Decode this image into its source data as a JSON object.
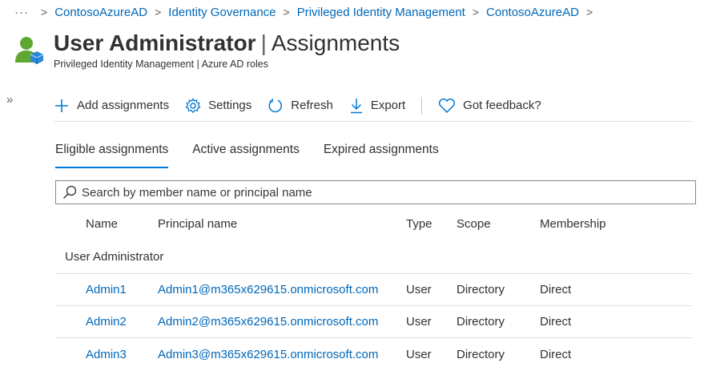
{
  "breadcrumb": {
    "ellipsis": "···",
    "items": [
      "ContosoAzureAD",
      "Identity Governance",
      "Privileged Identity Management",
      "ContosoAzureAD"
    ]
  },
  "header": {
    "title_strong": "User Administrator",
    "title_pipe": "|",
    "title_rest": "Assignments",
    "subtitle": "Privileged Identity Management | Azure AD roles"
  },
  "expand_label": "»",
  "toolbar": {
    "add": "Add assignments",
    "settings": "Settings",
    "refresh": "Refresh",
    "export": "Export",
    "feedback": "Got feedback?"
  },
  "tabs": [
    "Eligible assignments",
    "Active assignments",
    "Expired assignments"
  ],
  "search": {
    "placeholder": "Search by member name or principal name"
  },
  "table": {
    "headers": {
      "name": "Name",
      "principal": "Principal name",
      "type": "Type",
      "scope": "Scope",
      "membership": "Membership"
    },
    "group": "User Administrator",
    "rows": [
      {
        "name": "Admin1",
        "principal": "Admin1@m365x629615.onmicrosoft.com",
        "type": "User",
        "scope": "Directory",
        "membership": "Direct"
      },
      {
        "name": "Admin2",
        "principal": "Admin2@m365x629615.onmicrosoft.com",
        "type": "User",
        "scope": "Directory",
        "membership": "Direct"
      },
      {
        "name": "Admin3",
        "principal": "Admin3@m365x629615.onmicrosoft.com",
        "type": "User",
        "scope": "Directory",
        "membership": "Direct"
      }
    ]
  },
  "colors": {
    "link": "#0067b8",
    "accent": "#0078d4",
    "icon_green": "#5ea832",
    "icon_blue": "#2b88d8"
  }
}
